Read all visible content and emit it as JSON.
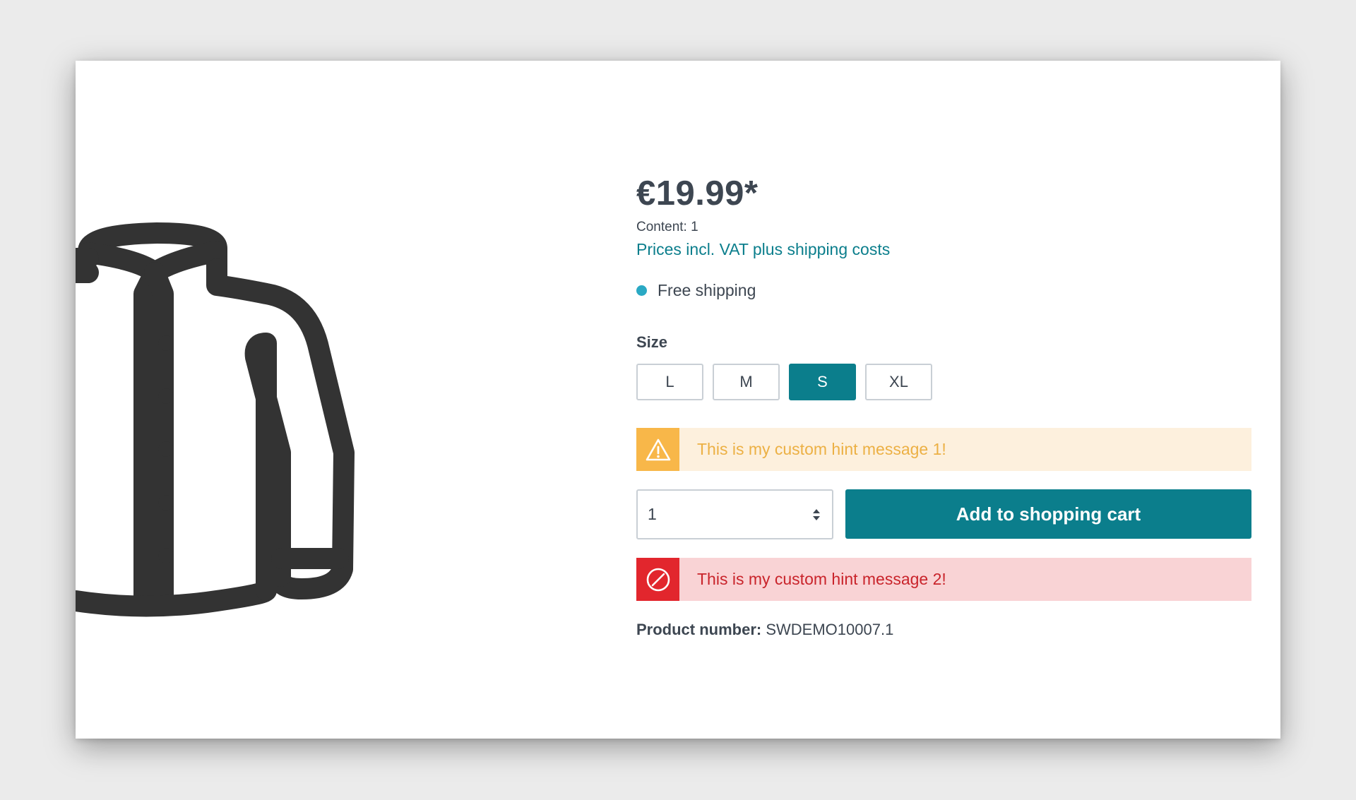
{
  "product": {
    "price": "€19.99*",
    "content": "Content: 1",
    "tax_link": "Prices incl. VAT plus shipping costs",
    "delivery": "Free shipping",
    "delivery_color": "#2aa9c4",
    "image_icon": "jacket-icon"
  },
  "size": {
    "label": "Size",
    "options": [
      "L",
      "M",
      "S",
      "XL"
    ],
    "selected": "S"
  },
  "hints": {
    "warning": {
      "text": "This is my custom hint message 1!",
      "icon": "warning-triangle-icon"
    },
    "danger": {
      "text": "This is my custom hint message 2!",
      "icon": "prohibited-icon"
    }
  },
  "buy": {
    "quantity": "1",
    "button_label": "Add to shopping cart"
  },
  "product_number": {
    "label": "Product number:",
    "value": "SWDEMO10007.1"
  },
  "colors": {
    "accent": "#0b7e8c",
    "warning": "#f8b749",
    "danger": "#e2262d",
    "text": "#3d4651"
  }
}
